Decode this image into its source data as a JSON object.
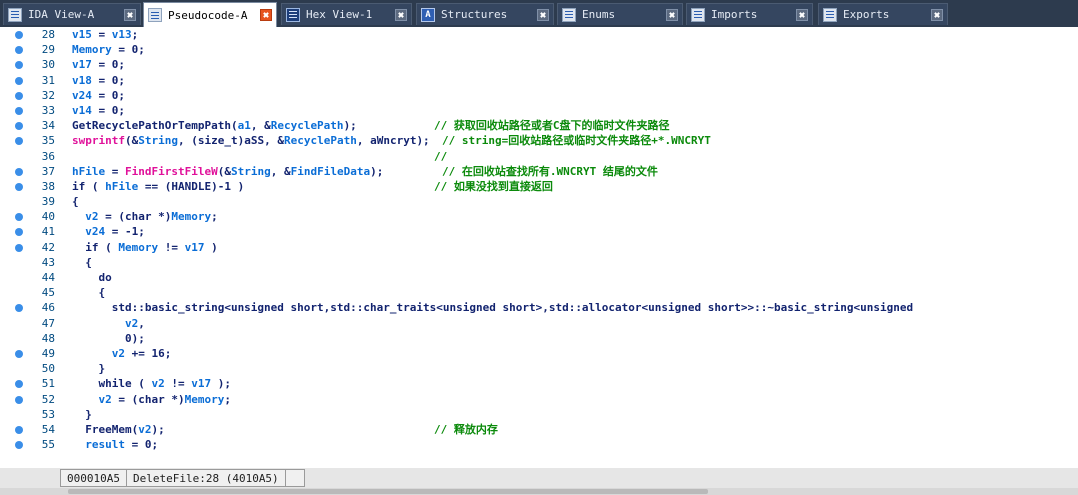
{
  "tabs": [
    {
      "label": "IDA View-A",
      "icon": "listing-icon",
      "active": false
    },
    {
      "label": "Pseudocode-A",
      "icon": "listing-icon",
      "active": true
    },
    {
      "label": "Hex View-1",
      "icon": "hex-icon",
      "active": false
    },
    {
      "label": "Structures",
      "icon": "structures-icon",
      "icon_glyph": "A",
      "active": false
    },
    {
      "label": "Enums",
      "icon": "enums-icon",
      "active": false
    },
    {
      "label": "Imports",
      "icon": "imports-icon",
      "active": false
    },
    {
      "label": "Exports",
      "icon": "exports-icon",
      "active": false
    }
  ],
  "colors": {
    "tabbar": "#2d3b4e",
    "active_close": "#e7541f",
    "breakpoint_dot": "#3a8ee8",
    "line_number": "#004a80",
    "variable": "#0a6dd6",
    "code_text": "#12236f",
    "library_call": "#e0119a",
    "comment": "#0b8a0b"
  },
  "code": [
    {
      "num": "28",
      "bp": true,
      "tokens": [
        [
          "v15",
          "var"
        ],
        [
          " = ",
          "pun"
        ],
        [
          "v13",
          "var"
        ],
        [
          ";",
          "pun"
        ]
      ]
    },
    {
      "num": "29",
      "bp": true,
      "tokens": [
        [
          "Memory",
          "var"
        ],
        [
          " = ",
          "pun"
        ],
        [
          "0",
          "num"
        ],
        [
          ";",
          "pun"
        ]
      ]
    },
    {
      "num": "30",
      "bp": true,
      "tokens": [
        [
          "v17",
          "var"
        ],
        [
          " = ",
          "pun"
        ],
        [
          "0",
          "num"
        ],
        [
          ";",
          "pun"
        ]
      ]
    },
    {
      "num": "31",
      "bp": true,
      "tokens": [
        [
          "v18",
          "var"
        ],
        [
          " = ",
          "pun"
        ],
        [
          "0",
          "num"
        ],
        [
          ";",
          "pun"
        ]
      ]
    },
    {
      "num": "32",
      "bp": true,
      "tokens": [
        [
          "v24",
          "var"
        ],
        [
          " = ",
          "pun"
        ],
        [
          "0",
          "num"
        ],
        [
          ";",
          "pun"
        ]
      ]
    },
    {
      "num": "33",
      "bp": true,
      "tokens": [
        [
          "v14",
          "var"
        ],
        [
          " = ",
          "pun"
        ],
        [
          "0",
          "num"
        ],
        [
          ";",
          "pun"
        ]
      ]
    },
    {
      "num": "34",
      "bp": true,
      "tokens": [
        [
          "GetRecyclePathOrTempPath",
          "fn"
        ],
        [
          "(",
          "pun"
        ],
        [
          "a1",
          "var"
        ],
        [
          ", &",
          "pun"
        ],
        [
          "RecyclePath",
          "var"
        ],
        [
          ");",
          "pun"
        ]
      ],
      "comment": "// 获取回收站路径或者C盘下的临时文件夹路径",
      "comment_col": 362
    },
    {
      "num": "35",
      "bp": true,
      "tokens": [
        [
          "swprintf",
          "lib"
        ],
        [
          "(&",
          "pun"
        ],
        [
          "String",
          "var"
        ],
        [
          ", (size_t)",
          "pun"
        ],
        [
          "aSS",
          "str"
        ],
        [
          ", &",
          "pun"
        ],
        [
          "RecyclePath",
          "var"
        ],
        [
          ", ",
          "pun"
        ],
        [
          "aWncryt",
          "str"
        ],
        [
          ");",
          "pun"
        ]
      ],
      "comment": "// string=回收站路径或临时文件夹路径+*.WNCRYT",
      "comment_col": 370
    },
    {
      "num": "36",
      "bp": false,
      "tokens": [],
      "comment": "//",
      "comment_col": 362
    },
    {
      "num": "37",
      "bp": true,
      "tokens": [
        [
          "hFile",
          "var"
        ],
        [
          " = ",
          "pun"
        ],
        [
          "FindFirstFileW",
          "lib"
        ],
        [
          "(&",
          "pun"
        ],
        [
          "String",
          "var"
        ],
        [
          ", &",
          "pun"
        ],
        [
          "FindFileData",
          "var"
        ],
        [
          ");",
          "pun"
        ]
      ],
      "comment": "// 在回收站查找所有.WNCRYT 结尾的文件",
      "comment_col": 370
    },
    {
      "num": "38",
      "bp": true,
      "tokens": [
        [
          "if",
          "kw"
        ],
        [
          " ( ",
          "pun"
        ],
        [
          "hFile",
          "var"
        ],
        [
          " == (HANDLE)-1 )",
          "pun"
        ]
      ],
      "comment": "// 如果没找到直接返回",
      "comment_col": 362
    },
    {
      "num": "39",
      "bp": false,
      "tokens": [
        [
          "{",
          "pun"
        ]
      ]
    },
    {
      "num": "40",
      "bp": true,
      "tokens": [
        [
          "  ",
          "pun"
        ],
        [
          "v2",
          "var"
        ],
        [
          " = (char *)",
          "pun"
        ],
        [
          "Memory",
          "var"
        ],
        [
          ";",
          "pun"
        ]
      ]
    },
    {
      "num": "41",
      "bp": true,
      "tokens": [
        [
          "  ",
          "pun"
        ],
        [
          "v24",
          "var"
        ],
        [
          " = -1;",
          "pun"
        ]
      ]
    },
    {
      "num": "42",
      "bp": true,
      "tokens": [
        [
          "  ",
          "pun"
        ],
        [
          "if",
          "kw"
        ],
        [
          " ( ",
          "pun"
        ],
        [
          "Memory",
          "var"
        ],
        [
          " != ",
          "pun"
        ],
        [
          "v17",
          "var"
        ],
        [
          " )",
          "pun"
        ]
      ]
    },
    {
      "num": "43",
      "bp": false,
      "tokens": [
        [
          "  {",
          "pun"
        ]
      ]
    },
    {
      "num": "44",
      "bp": false,
      "tokens": [
        [
          "    ",
          "pun"
        ],
        [
          "do",
          "kw"
        ]
      ]
    },
    {
      "num": "45",
      "bp": false,
      "tokens": [
        [
          "    {",
          "pun"
        ]
      ]
    },
    {
      "num": "46",
      "bp": true,
      "tokens": [
        [
          "      std::basic_string<unsigned short,std::char_traits<unsigned short>,std::allocator<unsigned short>>::~basic_string<unsigned",
          "ty"
        ]
      ]
    },
    {
      "num": "47",
      "bp": false,
      "tokens": [
        [
          "        ",
          "pun"
        ],
        [
          "v2",
          "var"
        ],
        [
          ",",
          "pun"
        ]
      ]
    },
    {
      "num": "48",
      "bp": false,
      "tokens": [
        [
          "        0);",
          "pun"
        ]
      ]
    },
    {
      "num": "49",
      "bp": true,
      "tokens": [
        [
          "      ",
          "pun"
        ],
        [
          "v2",
          "var"
        ],
        [
          " += 16;",
          "pun"
        ]
      ]
    },
    {
      "num": "50",
      "bp": false,
      "tokens": [
        [
          "    }",
          "pun"
        ]
      ]
    },
    {
      "num": "51",
      "bp": true,
      "tokens": [
        [
          "    ",
          "pun"
        ],
        [
          "while",
          "kw"
        ],
        [
          " ( ",
          "pun"
        ],
        [
          "v2",
          "var"
        ],
        [
          " != ",
          "pun"
        ],
        [
          "v17",
          "var"
        ],
        [
          " );",
          "pun"
        ]
      ]
    },
    {
      "num": "52",
      "bp": true,
      "tokens": [
        [
          "    ",
          "pun"
        ],
        [
          "v2",
          "var"
        ],
        [
          " = (char *)",
          "pun"
        ],
        [
          "Memory",
          "var"
        ],
        [
          ";",
          "pun"
        ]
      ]
    },
    {
      "num": "53",
      "bp": false,
      "tokens": [
        [
          "  }",
          "pun"
        ]
      ]
    },
    {
      "num": "54",
      "bp": true,
      "tokens": [
        [
          "  ",
          "pun"
        ],
        [
          "FreeMem",
          "fn"
        ],
        [
          "(",
          "pun"
        ],
        [
          "v2",
          "var"
        ],
        [
          ");",
          "pun"
        ]
      ],
      "comment": "// 释放内存",
      "comment_col": 362
    },
    {
      "num": "55",
      "bp": true,
      "tokens": [
        [
          "  ",
          "pun"
        ],
        [
          "result",
          "var"
        ],
        [
          " = ",
          "pun"
        ],
        [
          "0",
          "num"
        ],
        [
          ";",
          "pun"
        ]
      ]
    }
  ],
  "status": {
    "address": "000010A5",
    "location": "DeleteFile:28 (4010A5)"
  }
}
